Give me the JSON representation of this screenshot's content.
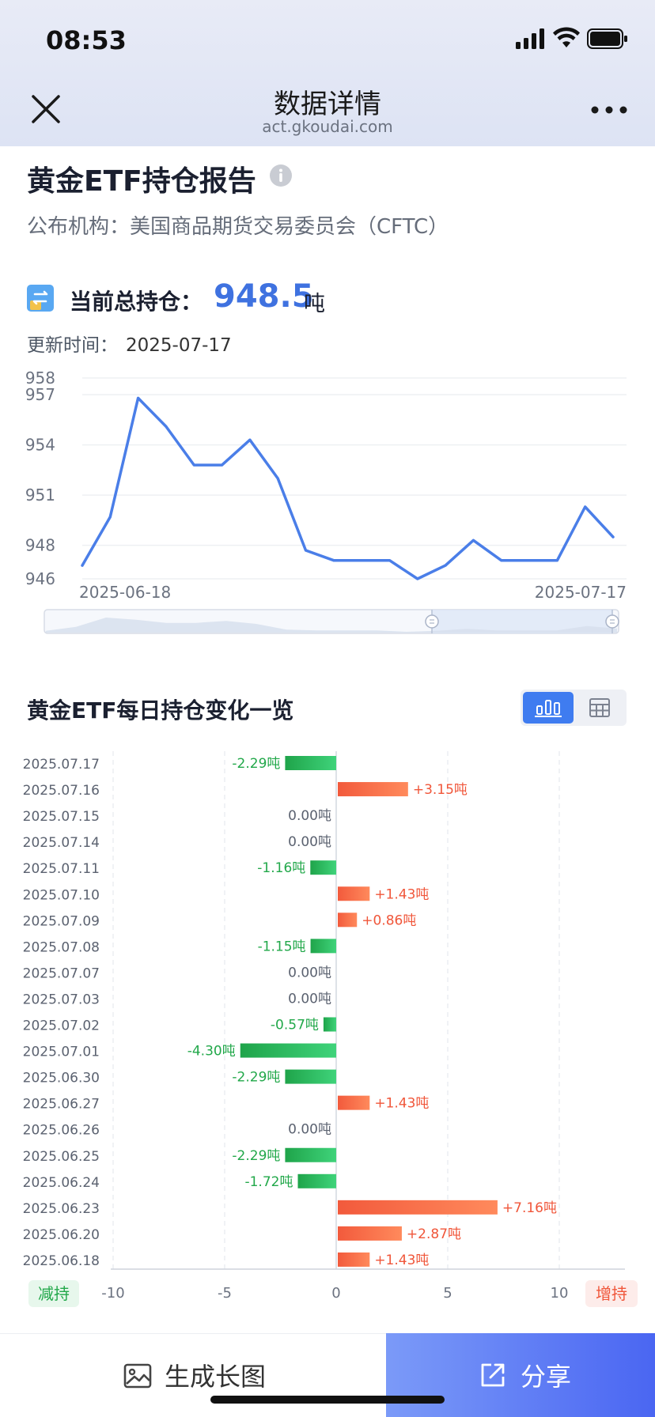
{
  "status_bar": {
    "time": "08:53"
  },
  "nav": {
    "title": "数据详情",
    "domain": "act.gkoudai.com"
  },
  "header": {
    "title": "黄金ETF持仓报告",
    "publisher": "公布机构：美国商品期货交易委员会（CFTC）"
  },
  "current": {
    "label": "当前总持仓：",
    "value": "948.5",
    "unit": "吨",
    "updated_label": "更新时间：",
    "updated_value": "2025-07-17"
  },
  "section2": {
    "title": "黄金ETF每日持仓变化一览"
  },
  "bottom": {
    "generate_label": "生成长图",
    "share_label": "分享"
  },
  "colors": {
    "accent": "#3f72e0",
    "line": "#4a7ee8",
    "decrease": "#22a84a",
    "increase": "#f0563a"
  },
  "icons": [
    "close-icon",
    "more-icon",
    "info-icon",
    "transfer-icon",
    "bar-chart-icon",
    "table-icon",
    "image-icon",
    "share-icon"
  ],
  "chart_data": [
    {
      "type": "line",
      "x": [
        "2025-06-18",
        "2025-06-20",
        "2025-06-23",
        "2025-06-24",
        "2025-06-25",
        "2025-06-26",
        "2025-06-27",
        "2025-06-30",
        "2025-07-01",
        "2025-07-02",
        "2025-07-03",
        "2025-07-07",
        "2025-07-08",
        "2025-07-09",
        "2025-07-10",
        "2025-07-11",
        "2025-07-14",
        "2025-07-15",
        "2025-07-16",
        "2025-07-17"
      ],
      "values": [
        946.8,
        949.7,
        956.8,
        955.1,
        952.8,
        952.8,
        954.3,
        952.0,
        947.7,
        947.1,
        947.1,
        947.1,
        946.0,
        946.8,
        948.3,
        947.1,
        947.1,
        947.1,
        950.3,
        948.5
      ],
      "x_tick_labels": [
        "2025-06-18",
        "2025-07-17"
      ],
      "y_ticks": [
        946,
        948,
        951,
        954,
        957,
        958
      ],
      "ylim": [
        946,
        958
      ],
      "grid": true
    },
    {
      "type": "bar",
      "orientation": "horizontal",
      "categories": [
        "2025.07.17",
        "2025.07.16",
        "2025.07.15",
        "2025.07.14",
        "2025.07.11",
        "2025.07.10",
        "2025.07.09",
        "2025.07.08",
        "2025.07.07",
        "2025.07.03",
        "2025.07.02",
        "2025.07.01",
        "2025.06.30",
        "2025.06.27",
        "2025.06.26",
        "2025.06.25",
        "2025.06.24",
        "2025.06.23",
        "2025.06.20",
        "2025.06.18"
      ],
      "values": [
        -2.29,
        3.15,
        0.0,
        0.0,
        -1.16,
        1.43,
        0.86,
        -1.15,
        0.0,
        0.0,
        -0.57,
        -4.3,
        -2.29,
        1.43,
        0.0,
        -2.29,
        -1.72,
        7.16,
        2.87,
        1.43
      ],
      "value_labels": [
        "-2.29吨",
        "+3.15吨",
        "0.00吨",
        "0.00吨",
        "-1.16吨",
        "+1.43吨",
        "+0.86吨",
        "-1.15吨",
        "0.00吨",
        "0.00吨",
        "-0.57吨",
        "-4.30吨",
        "-2.29吨",
        "+1.43吨",
        "0.00吨",
        "-2.29吨",
        "-1.72吨",
        "+7.16吨",
        "+2.87吨",
        "+1.43吨"
      ],
      "x_ticks": [
        -10,
        -5,
        0,
        5,
        10
      ],
      "xlim": [
        -10,
        13
      ],
      "left_tag": "减持",
      "right_tag": "增持",
      "grid": true
    }
  ]
}
